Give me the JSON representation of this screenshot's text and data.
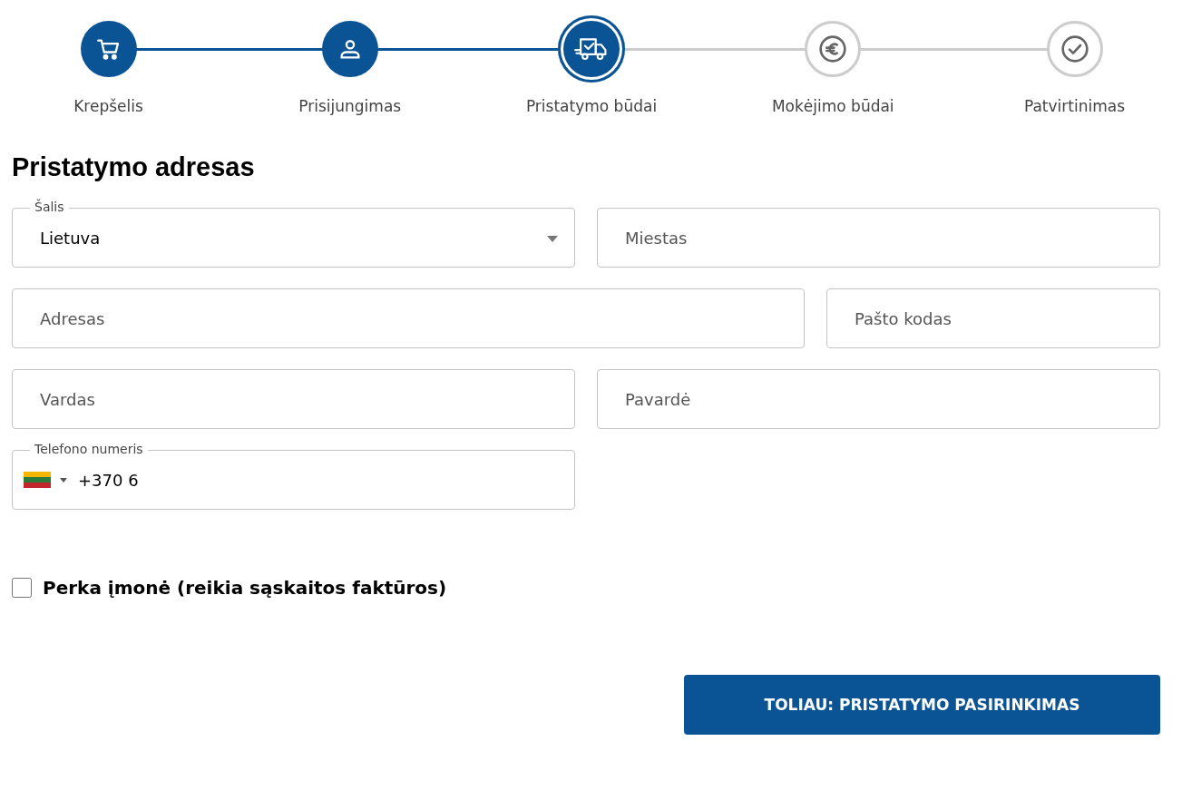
{
  "steps": [
    {
      "label": "Krepšelis",
      "completed": true,
      "selected": false
    },
    {
      "label": "Prisijungimas",
      "completed": true,
      "selected": false
    },
    {
      "label": "Pristatymo būdai",
      "completed": false,
      "selected": true
    },
    {
      "label": "Mokėjimo būdai",
      "completed": false,
      "selected": false
    },
    {
      "label": "Patvirtinimas",
      "completed": false,
      "selected": false
    }
  ],
  "heading": "Pristatymo adresas",
  "rows": [
    [
      {
        "kind": "select",
        "label": "Šalis",
        "value": "Lietuva"
      },
      {
        "kind": "text",
        "placeholder": "Miestas"
      }
    ],
    [
      {
        "kind": "text",
        "placeholder": "Adresas"
      },
      {
        "kind": "text",
        "placeholder": "Pašto kodas"
      }
    ],
    [
      {
        "kind": "text",
        "placeholder": "Vardas"
      },
      {
        "kind": "text",
        "placeholder": "Pavardė"
      }
    ],
    [
      {
        "kind": "phone",
        "label": "Telefono numeris",
        "value": "+370 6"
      }
    ]
  ],
  "company_checkbox": {
    "label": "Perka įmonė (reikia sąskaitos faktūros)",
    "checked": false
  },
  "next_button": "TOLIAU: PRISTATYMO PASIRINKIMAS"
}
